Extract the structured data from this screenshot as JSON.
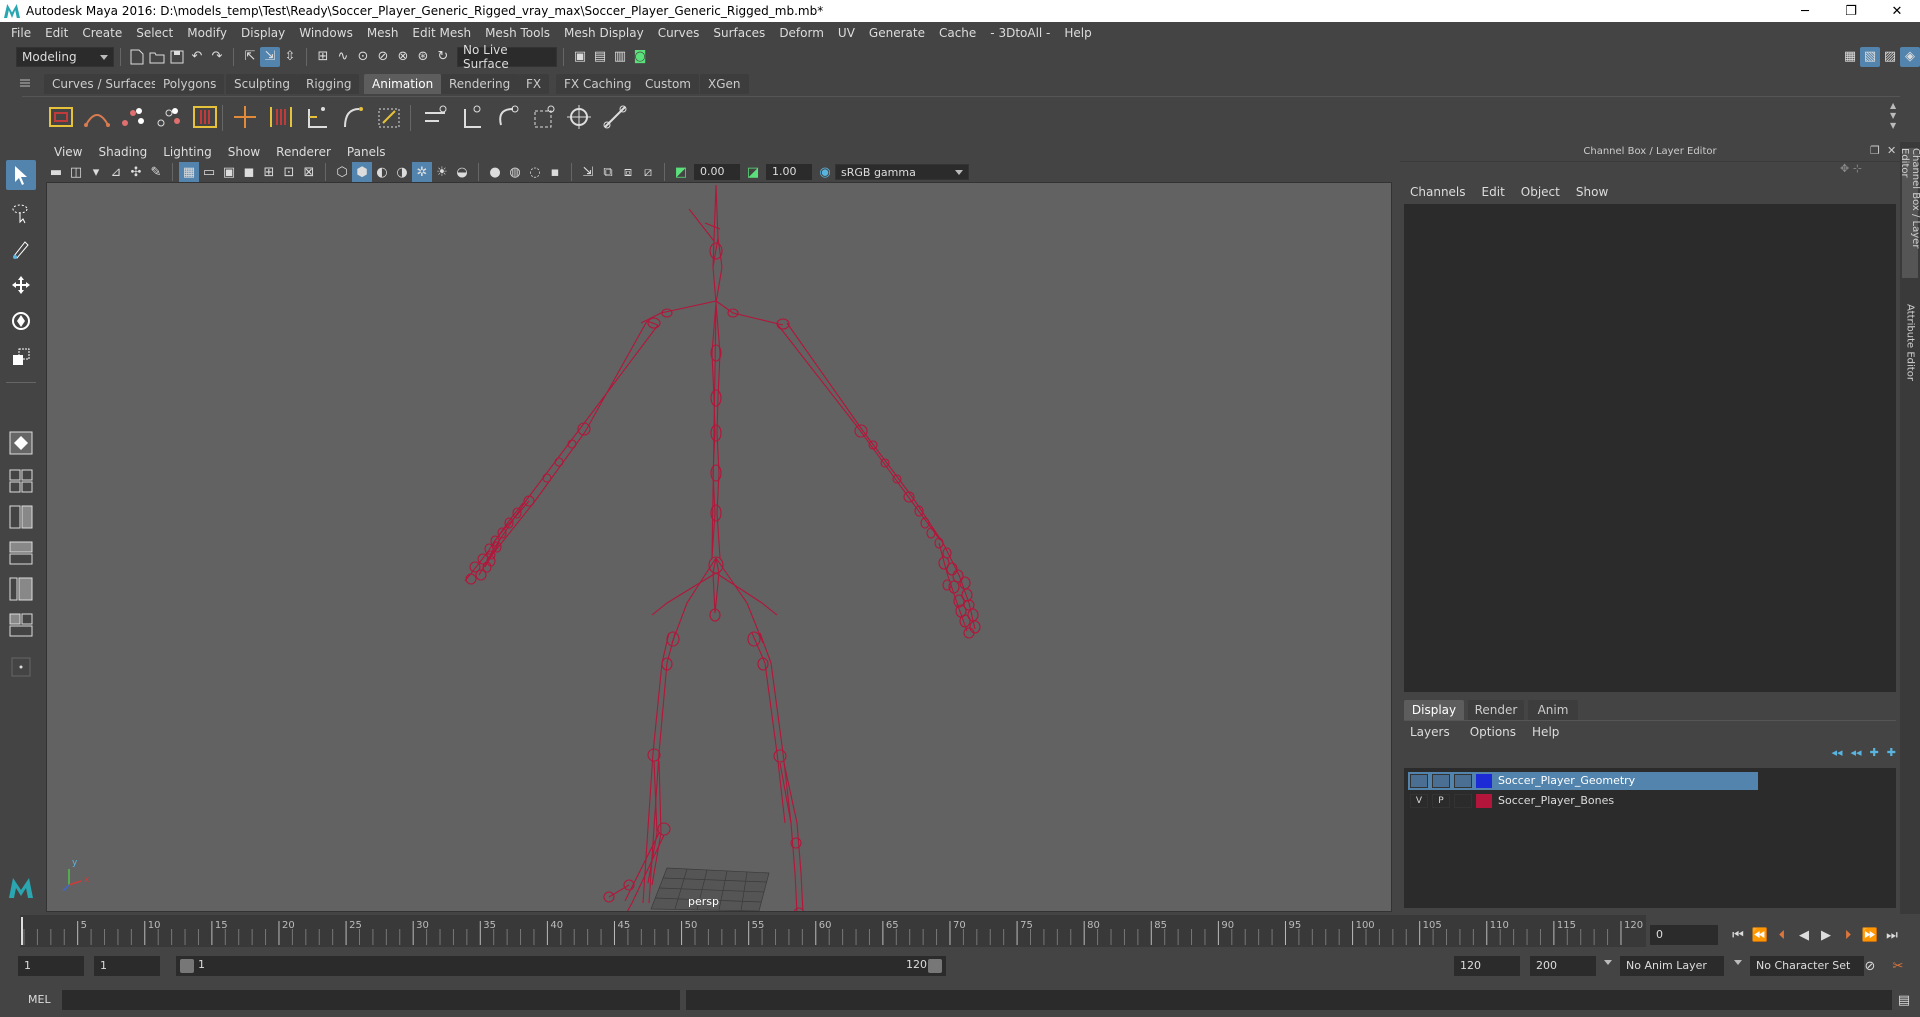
{
  "window": {
    "title": "Autodesk Maya 2016: D:\\models_temp\\Test\\Ready\\Soccer_Player_Generic_Rigged_vray_max\\Soccer_Player_Generic_Rigged_mb.mb*",
    "minimize": "─",
    "maximize": "❐",
    "close": "✕"
  },
  "menubar": [
    "File",
    "Edit",
    "Create",
    "Select",
    "Modify",
    "Display",
    "Windows",
    "Mesh",
    "Edit Mesh",
    "Mesh Tools",
    "Mesh Display",
    "Curves",
    "Surfaces",
    "Deform",
    "UV",
    "Generate",
    "Cache",
    "- 3DtoAll -",
    "Help"
  ],
  "statusline": {
    "mode": "Modeling",
    "live_surface": "No Live Surface"
  },
  "shelf_tabs": [
    "Curves / Surfaces",
    "Polygons",
    "Sculpting",
    "Rigging",
    "Animation",
    "Rendering",
    "FX",
    "FX Caching",
    "Custom",
    "XGen"
  ],
  "shelf_active": "Animation",
  "viewport": {
    "menus": [
      "View",
      "Shading",
      "Lighting",
      "Show",
      "Renderer",
      "Panels"
    ],
    "exposure": "0.00",
    "gamma": "1.00",
    "color_space": "sRGB gamma",
    "camera_label": "persp",
    "axis_x": "x",
    "axis_y": "y",
    "axis_z": "z"
  },
  "channel_box": {
    "title": "Channel Box / Layer Editor",
    "menus": [
      "Channels",
      "Edit",
      "Object",
      "Show"
    ]
  },
  "layer_editor": {
    "tabs": [
      "Display",
      "Render",
      "Anim"
    ],
    "active_tab": "Display",
    "menus": [
      "Layers",
      "Options",
      "Help"
    ],
    "layers": [
      {
        "v": "",
        "p": "",
        "color": "#1c2bd6",
        "name": "Soccer_Player_Geometry",
        "selected": true
      },
      {
        "v": "V",
        "p": "P",
        "color": "#b3163a",
        "name": "Soccer_Player_Bones",
        "selected": false
      }
    ]
  },
  "side_tabs": [
    "Channel Box / Layer Editor",
    "Attribute Editor"
  ],
  "timeline": {
    "ticks": [
      "5",
      "10",
      "15",
      "20",
      "25",
      "30",
      "35",
      "40",
      "45",
      "50",
      "55",
      "60",
      "65",
      "70",
      "75",
      "80",
      "85",
      "90",
      "95",
      "100",
      "105",
      "110",
      "115",
      "120"
    ],
    "current_frame": "0"
  },
  "range": {
    "start": "1",
    "playback_start": "1",
    "slider_start": "1",
    "slider_end": "120",
    "playback_end": "120",
    "end": "200",
    "anim_layer": "No Anim Layer",
    "character_set": "No Character Set"
  },
  "command_line": {
    "label": "MEL"
  },
  "colors": {
    "skeleton": "#b3163a",
    "accent": "#5284ad",
    "selected_layer": "#5284ad"
  }
}
